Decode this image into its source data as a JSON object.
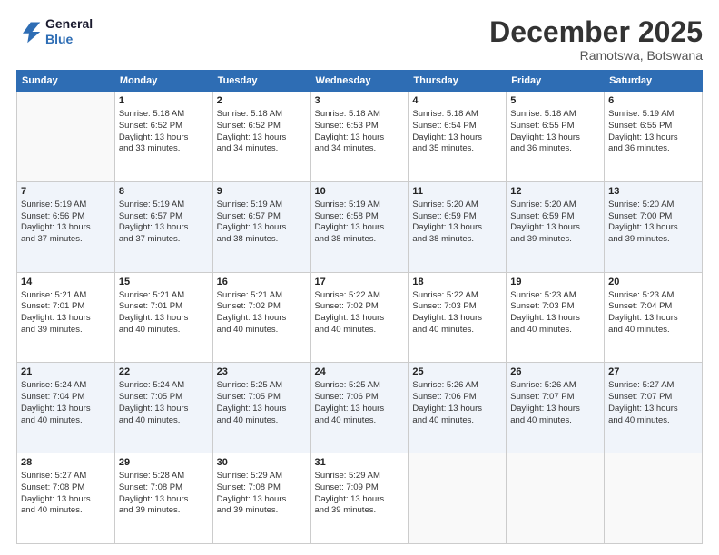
{
  "logo": {
    "line1": "General",
    "line2": "Blue"
  },
  "title": "December 2025",
  "location": "Ramotswa, Botswana",
  "days_of_week": [
    "Sunday",
    "Monday",
    "Tuesday",
    "Wednesday",
    "Thursday",
    "Friday",
    "Saturday"
  ],
  "weeks": [
    [
      {
        "day": "",
        "sunrise": "",
        "sunset": "",
        "daylight": ""
      },
      {
        "day": "1",
        "sunrise": "Sunrise: 5:18 AM",
        "sunset": "Sunset: 6:52 PM",
        "daylight": "Daylight: 13 hours and 33 minutes."
      },
      {
        "day": "2",
        "sunrise": "Sunrise: 5:18 AM",
        "sunset": "Sunset: 6:52 PM",
        "daylight": "Daylight: 13 hours and 34 minutes."
      },
      {
        "day": "3",
        "sunrise": "Sunrise: 5:18 AM",
        "sunset": "Sunset: 6:53 PM",
        "daylight": "Daylight: 13 hours and 34 minutes."
      },
      {
        "day": "4",
        "sunrise": "Sunrise: 5:18 AM",
        "sunset": "Sunset: 6:54 PM",
        "daylight": "Daylight: 13 hours and 35 minutes."
      },
      {
        "day": "5",
        "sunrise": "Sunrise: 5:18 AM",
        "sunset": "Sunset: 6:55 PM",
        "daylight": "Daylight: 13 hours and 36 minutes."
      },
      {
        "day": "6",
        "sunrise": "Sunrise: 5:19 AM",
        "sunset": "Sunset: 6:55 PM",
        "daylight": "Daylight: 13 hours and 36 minutes."
      }
    ],
    [
      {
        "day": "7",
        "sunrise": "Sunrise: 5:19 AM",
        "sunset": "Sunset: 6:56 PM",
        "daylight": "Daylight: 13 hours and 37 minutes."
      },
      {
        "day": "8",
        "sunrise": "Sunrise: 5:19 AM",
        "sunset": "Sunset: 6:57 PM",
        "daylight": "Daylight: 13 hours and 37 minutes."
      },
      {
        "day": "9",
        "sunrise": "Sunrise: 5:19 AM",
        "sunset": "Sunset: 6:57 PM",
        "daylight": "Daylight: 13 hours and 38 minutes."
      },
      {
        "day": "10",
        "sunrise": "Sunrise: 5:19 AM",
        "sunset": "Sunset: 6:58 PM",
        "daylight": "Daylight: 13 hours and 38 minutes."
      },
      {
        "day": "11",
        "sunrise": "Sunrise: 5:20 AM",
        "sunset": "Sunset: 6:59 PM",
        "daylight": "Daylight: 13 hours and 38 minutes."
      },
      {
        "day": "12",
        "sunrise": "Sunrise: 5:20 AM",
        "sunset": "Sunset: 6:59 PM",
        "daylight": "Daylight: 13 hours and 39 minutes."
      },
      {
        "day": "13",
        "sunrise": "Sunrise: 5:20 AM",
        "sunset": "Sunset: 7:00 PM",
        "daylight": "Daylight: 13 hours and 39 minutes."
      }
    ],
    [
      {
        "day": "14",
        "sunrise": "Sunrise: 5:21 AM",
        "sunset": "Sunset: 7:01 PM",
        "daylight": "Daylight: 13 hours and 39 minutes."
      },
      {
        "day": "15",
        "sunrise": "Sunrise: 5:21 AM",
        "sunset": "Sunset: 7:01 PM",
        "daylight": "Daylight: 13 hours and 40 minutes."
      },
      {
        "day": "16",
        "sunrise": "Sunrise: 5:21 AM",
        "sunset": "Sunset: 7:02 PM",
        "daylight": "Daylight: 13 hours and 40 minutes."
      },
      {
        "day": "17",
        "sunrise": "Sunrise: 5:22 AM",
        "sunset": "Sunset: 7:02 PM",
        "daylight": "Daylight: 13 hours and 40 minutes."
      },
      {
        "day": "18",
        "sunrise": "Sunrise: 5:22 AM",
        "sunset": "Sunset: 7:03 PM",
        "daylight": "Daylight: 13 hours and 40 minutes."
      },
      {
        "day": "19",
        "sunrise": "Sunrise: 5:23 AM",
        "sunset": "Sunset: 7:03 PM",
        "daylight": "Daylight: 13 hours and 40 minutes."
      },
      {
        "day": "20",
        "sunrise": "Sunrise: 5:23 AM",
        "sunset": "Sunset: 7:04 PM",
        "daylight": "Daylight: 13 hours and 40 minutes."
      }
    ],
    [
      {
        "day": "21",
        "sunrise": "Sunrise: 5:24 AM",
        "sunset": "Sunset: 7:04 PM",
        "daylight": "Daylight: 13 hours and 40 minutes."
      },
      {
        "day": "22",
        "sunrise": "Sunrise: 5:24 AM",
        "sunset": "Sunset: 7:05 PM",
        "daylight": "Daylight: 13 hours and 40 minutes."
      },
      {
        "day": "23",
        "sunrise": "Sunrise: 5:25 AM",
        "sunset": "Sunset: 7:05 PM",
        "daylight": "Daylight: 13 hours and 40 minutes."
      },
      {
        "day": "24",
        "sunrise": "Sunrise: 5:25 AM",
        "sunset": "Sunset: 7:06 PM",
        "daylight": "Daylight: 13 hours and 40 minutes."
      },
      {
        "day": "25",
        "sunrise": "Sunrise: 5:26 AM",
        "sunset": "Sunset: 7:06 PM",
        "daylight": "Daylight: 13 hours and 40 minutes."
      },
      {
        "day": "26",
        "sunrise": "Sunrise: 5:26 AM",
        "sunset": "Sunset: 7:07 PM",
        "daylight": "Daylight: 13 hours and 40 minutes."
      },
      {
        "day": "27",
        "sunrise": "Sunrise: 5:27 AM",
        "sunset": "Sunset: 7:07 PM",
        "daylight": "Daylight: 13 hours and 40 minutes."
      }
    ],
    [
      {
        "day": "28",
        "sunrise": "Sunrise: 5:27 AM",
        "sunset": "Sunset: 7:08 PM",
        "daylight": "Daylight: 13 hours and 40 minutes."
      },
      {
        "day": "29",
        "sunrise": "Sunrise: 5:28 AM",
        "sunset": "Sunset: 7:08 PM",
        "daylight": "Daylight: 13 hours and 39 minutes."
      },
      {
        "day": "30",
        "sunrise": "Sunrise: 5:29 AM",
        "sunset": "Sunset: 7:08 PM",
        "daylight": "Daylight: 13 hours and 39 minutes."
      },
      {
        "day": "31",
        "sunrise": "Sunrise: 5:29 AM",
        "sunset": "Sunset: 7:09 PM",
        "daylight": "Daylight: 13 hours and 39 minutes."
      },
      {
        "day": "",
        "sunrise": "",
        "sunset": "",
        "daylight": ""
      },
      {
        "day": "",
        "sunrise": "",
        "sunset": "",
        "daylight": ""
      },
      {
        "day": "",
        "sunrise": "",
        "sunset": "",
        "daylight": ""
      }
    ]
  ]
}
